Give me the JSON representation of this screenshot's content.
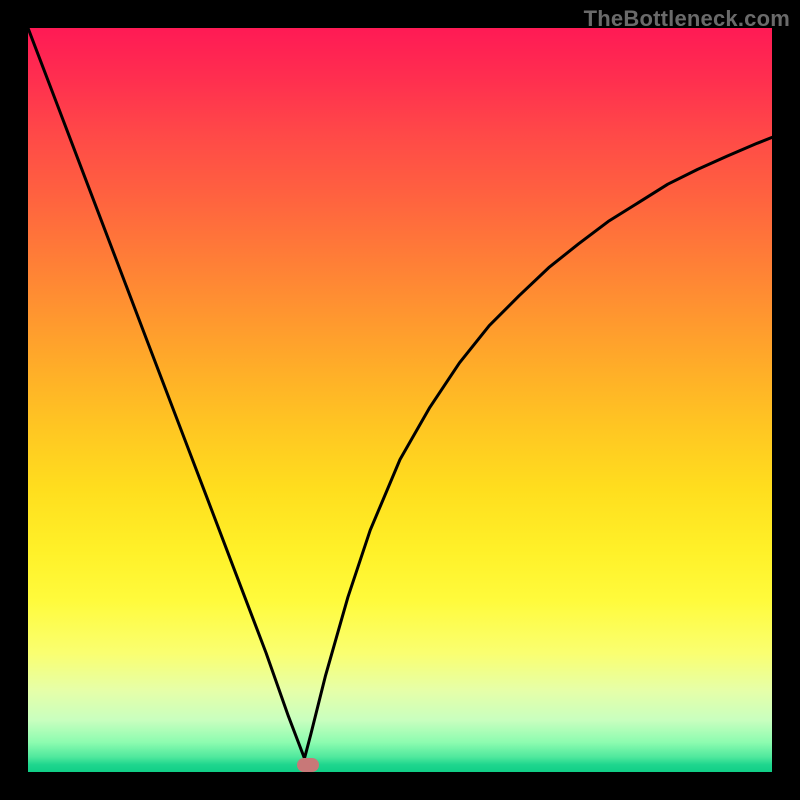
{
  "watermark": "TheBottleneck.com",
  "chart_data": {
    "type": "line",
    "title": "",
    "xlabel": "",
    "ylabel": "",
    "xlim": [
      0,
      1
    ],
    "ylim": [
      0,
      1
    ],
    "grid": false,
    "legend": false,
    "series": [
      {
        "name": "bottleneck-curve",
        "x": [
          0.0,
          0.04,
          0.08,
          0.12,
          0.16,
          0.2,
          0.24,
          0.28,
          0.32,
          0.35,
          0.371,
          0.372,
          0.38,
          0.4,
          0.43,
          0.46,
          0.5,
          0.54,
          0.58,
          0.62,
          0.66,
          0.7,
          0.74,
          0.78,
          0.82,
          0.86,
          0.9,
          0.94,
          0.98,
          1.0
        ],
        "y": [
          1.0,
          0.895,
          0.79,
          0.685,
          0.58,
          0.475,
          0.37,
          0.265,
          0.16,
          0.075,
          0.02,
          0.02,
          0.05,
          0.13,
          0.235,
          0.325,
          0.42,
          0.49,
          0.55,
          0.6,
          0.64,
          0.678,
          0.71,
          0.74,
          0.765,
          0.79,
          0.81,
          0.828,
          0.845,
          0.853
        ]
      }
    ],
    "gradient_colors": {
      "top": "#ff1a55",
      "middle": "#ffde1e",
      "bottom": "#10cf87"
    },
    "marker": {
      "x": 0.376,
      "y": 0.01,
      "color": "#c87878"
    },
    "curve_color": "#000000",
    "curve_width": 3
  }
}
